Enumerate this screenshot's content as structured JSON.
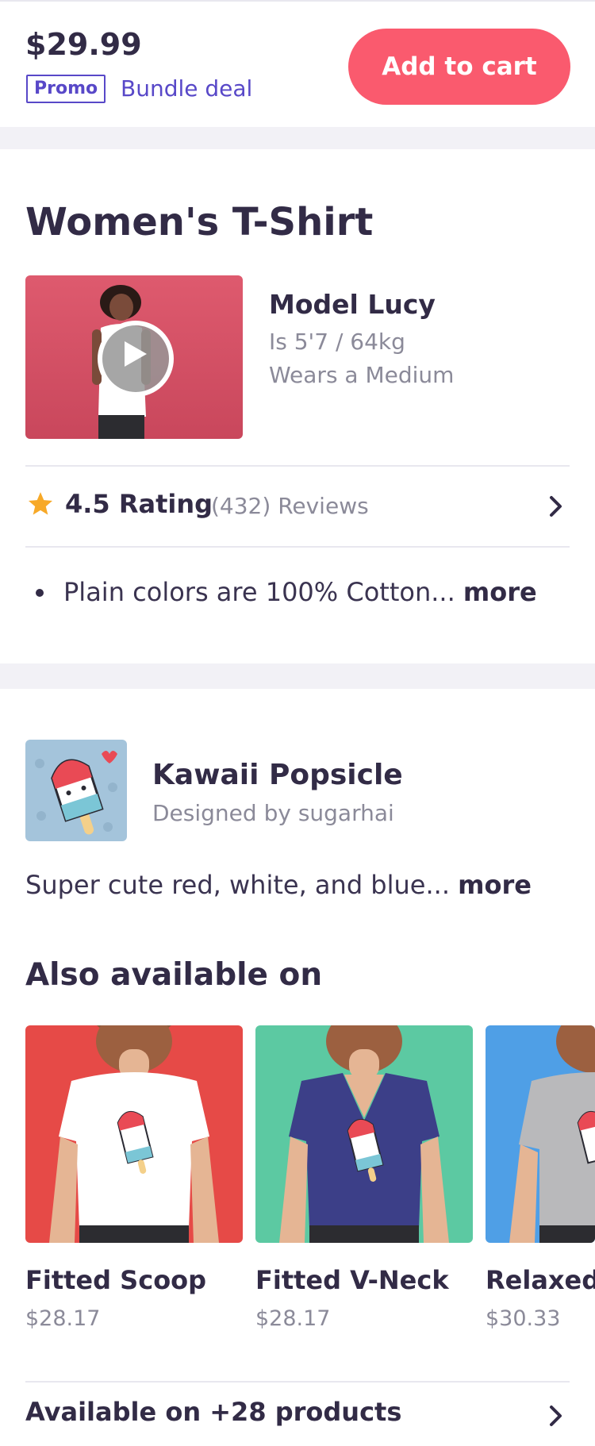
{
  "purchase_bar": {
    "price": "$29.99",
    "promo_label": "Promo",
    "bundle_label": "Bundle deal",
    "add_to_cart_label": "Add to cart"
  },
  "product": {
    "title": "Women's T-Shirt",
    "model": {
      "name": "Model Lucy",
      "line1": "Is 5'7 / 64kg",
      "line2": "Wears a Medium"
    },
    "rating": {
      "value_label": "4.5 Rating",
      "reviews_label": "(432) Reviews"
    },
    "bullet": "Plain colors are 100% Cotton...",
    "more_label": "more"
  },
  "design": {
    "title": "Kawaii Popsicle",
    "designer": "Designed by sugarhai",
    "description": "Super cute red, white, and blue...",
    "more_label": "more"
  },
  "also_available": {
    "heading": "Also available on",
    "items": [
      {
        "name": "Fitted Scoop",
        "price": "$28.17",
        "bg": "#e64a47",
        "shirt": "#ffffff"
      },
      {
        "name": "Fitted V-Neck",
        "price": "$28.17",
        "bg": "#5cc9a2",
        "shirt": "#3c3f88"
      },
      {
        "name": "Relaxed",
        "price": "$30.33",
        "bg": "#4f9fe6",
        "shirt": "#b9b9bb"
      }
    ],
    "more_products_label": "Available on +28 products"
  },
  "colors": {
    "accent": "#5848c8",
    "cta": "#fa5a6e",
    "star": "#f7a928"
  }
}
